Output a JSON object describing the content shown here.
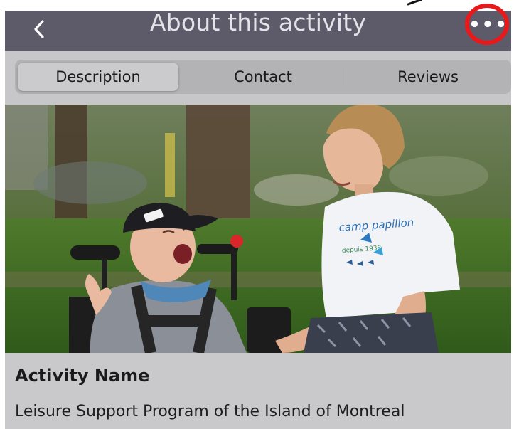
{
  "header": {
    "title": "About this activity",
    "back_icon": "chevron-left-icon",
    "more_icon": "more-horizontal-icon",
    "background_color": "#5d5a6a"
  },
  "annotation": {
    "highlight_color": "#e8191b"
  },
  "tabs": [
    {
      "label": "Description",
      "active": true
    },
    {
      "label": "Contact",
      "active": false
    },
    {
      "label": "Reviews",
      "active": false
    }
  ],
  "photo": {
    "shirt_text_line1": "camp papillon",
    "shirt_text_line2": "depuis 1938"
  },
  "details": {
    "label": "Activity Name",
    "value": "Leisure Support Program of the Island of Montreal"
  }
}
